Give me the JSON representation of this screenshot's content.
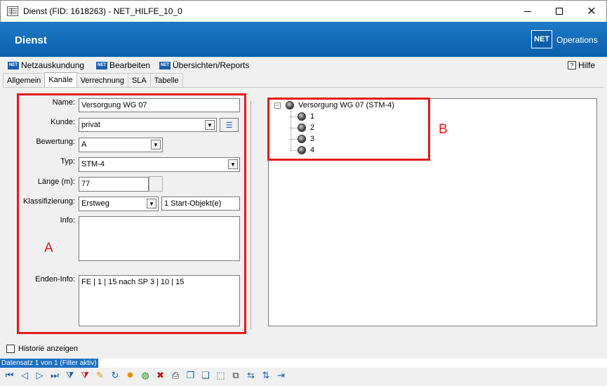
{
  "window": {
    "title": "Dienst (FID: 1618263) - NET_HILFE_10_0",
    "minimize_glyph": "",
    "close_glyph": "✕"
  },
  "header": {
    "title": "Dienst",
    "logo_text": "NET",
    "brand": "Operations"
  },
  "menu": {
    "icon_text": "NET",
    "items": [
      "Netzauskundung",
      "Bearbeiten",
      "Übersichten/Reports"
    ],
    "help_icon": "?",
    "help": "Hilfe"
  },
  "tabs": [
    "Allgemein",
    "Kanäle",
    "Verrechnung",
    "SLA",
    "Tabelle"
  ],
  "active_tab": "Kanäle",
  "form": {
    "name_label": "Name:",
    "name_value": "Versorgung WG 07",
    "kunde_label": "Kunde:",
    "kunde_value": "privat",
    "bewertung_label": "Bewertung:",
    "bewertung_value": "A",
    "typ_label": "Typ:",
    "typ_value": "STM-4",
    "laenge_label": "Länge (m):",
    "laenge_value": "77",
    "klassifizierung_label": "Klassifizierung:",
    "klassifizierung_value": "Erstweg",
    "start_objekt": "1 Start-Objekt(e)",
    "info_label": "Info:",
    "info_value": "",
    "enden_label": "Enden-Info:",
    "enden_value": "FE | 1 | 15 nach SP 3 | 10 | 15"
  },
  "tree": {
    "root": "Versorgung WG 07 (STM-4)",
    "children": [
      "1",
      "2",
      "3",
      "4"
    ]
  },
  "annotations": {
    "a": "A",
    "b": "B",
    "color": "#e51919"
  },
  "bottom": {
    "history_label": "Historie anzeigen",
    "status": "Datensatz 1 von 1 (Filter aktiv)"
  },
  "toolbar_icons": [
    "first-icon",
    "prev-icon",
    "next-icon",
    "last-icon",
    "filter-add-icon",
    "filter-remove-icon",
    "edit-icon",
    "refresh-icon",
    "new-icon",
    "web-icon",
    "delete-icon",
    "print-icon",
    "copy-icon",
    "duplicate-icon",
    "select-icon",
    "link-icon",
    "transfer-icon",
    "settings-icon",
    "exit-icon"
  ],
  "colors": {
    "accent": "#0b5fab",
    "status": "#1b6fc5"
  }
}
